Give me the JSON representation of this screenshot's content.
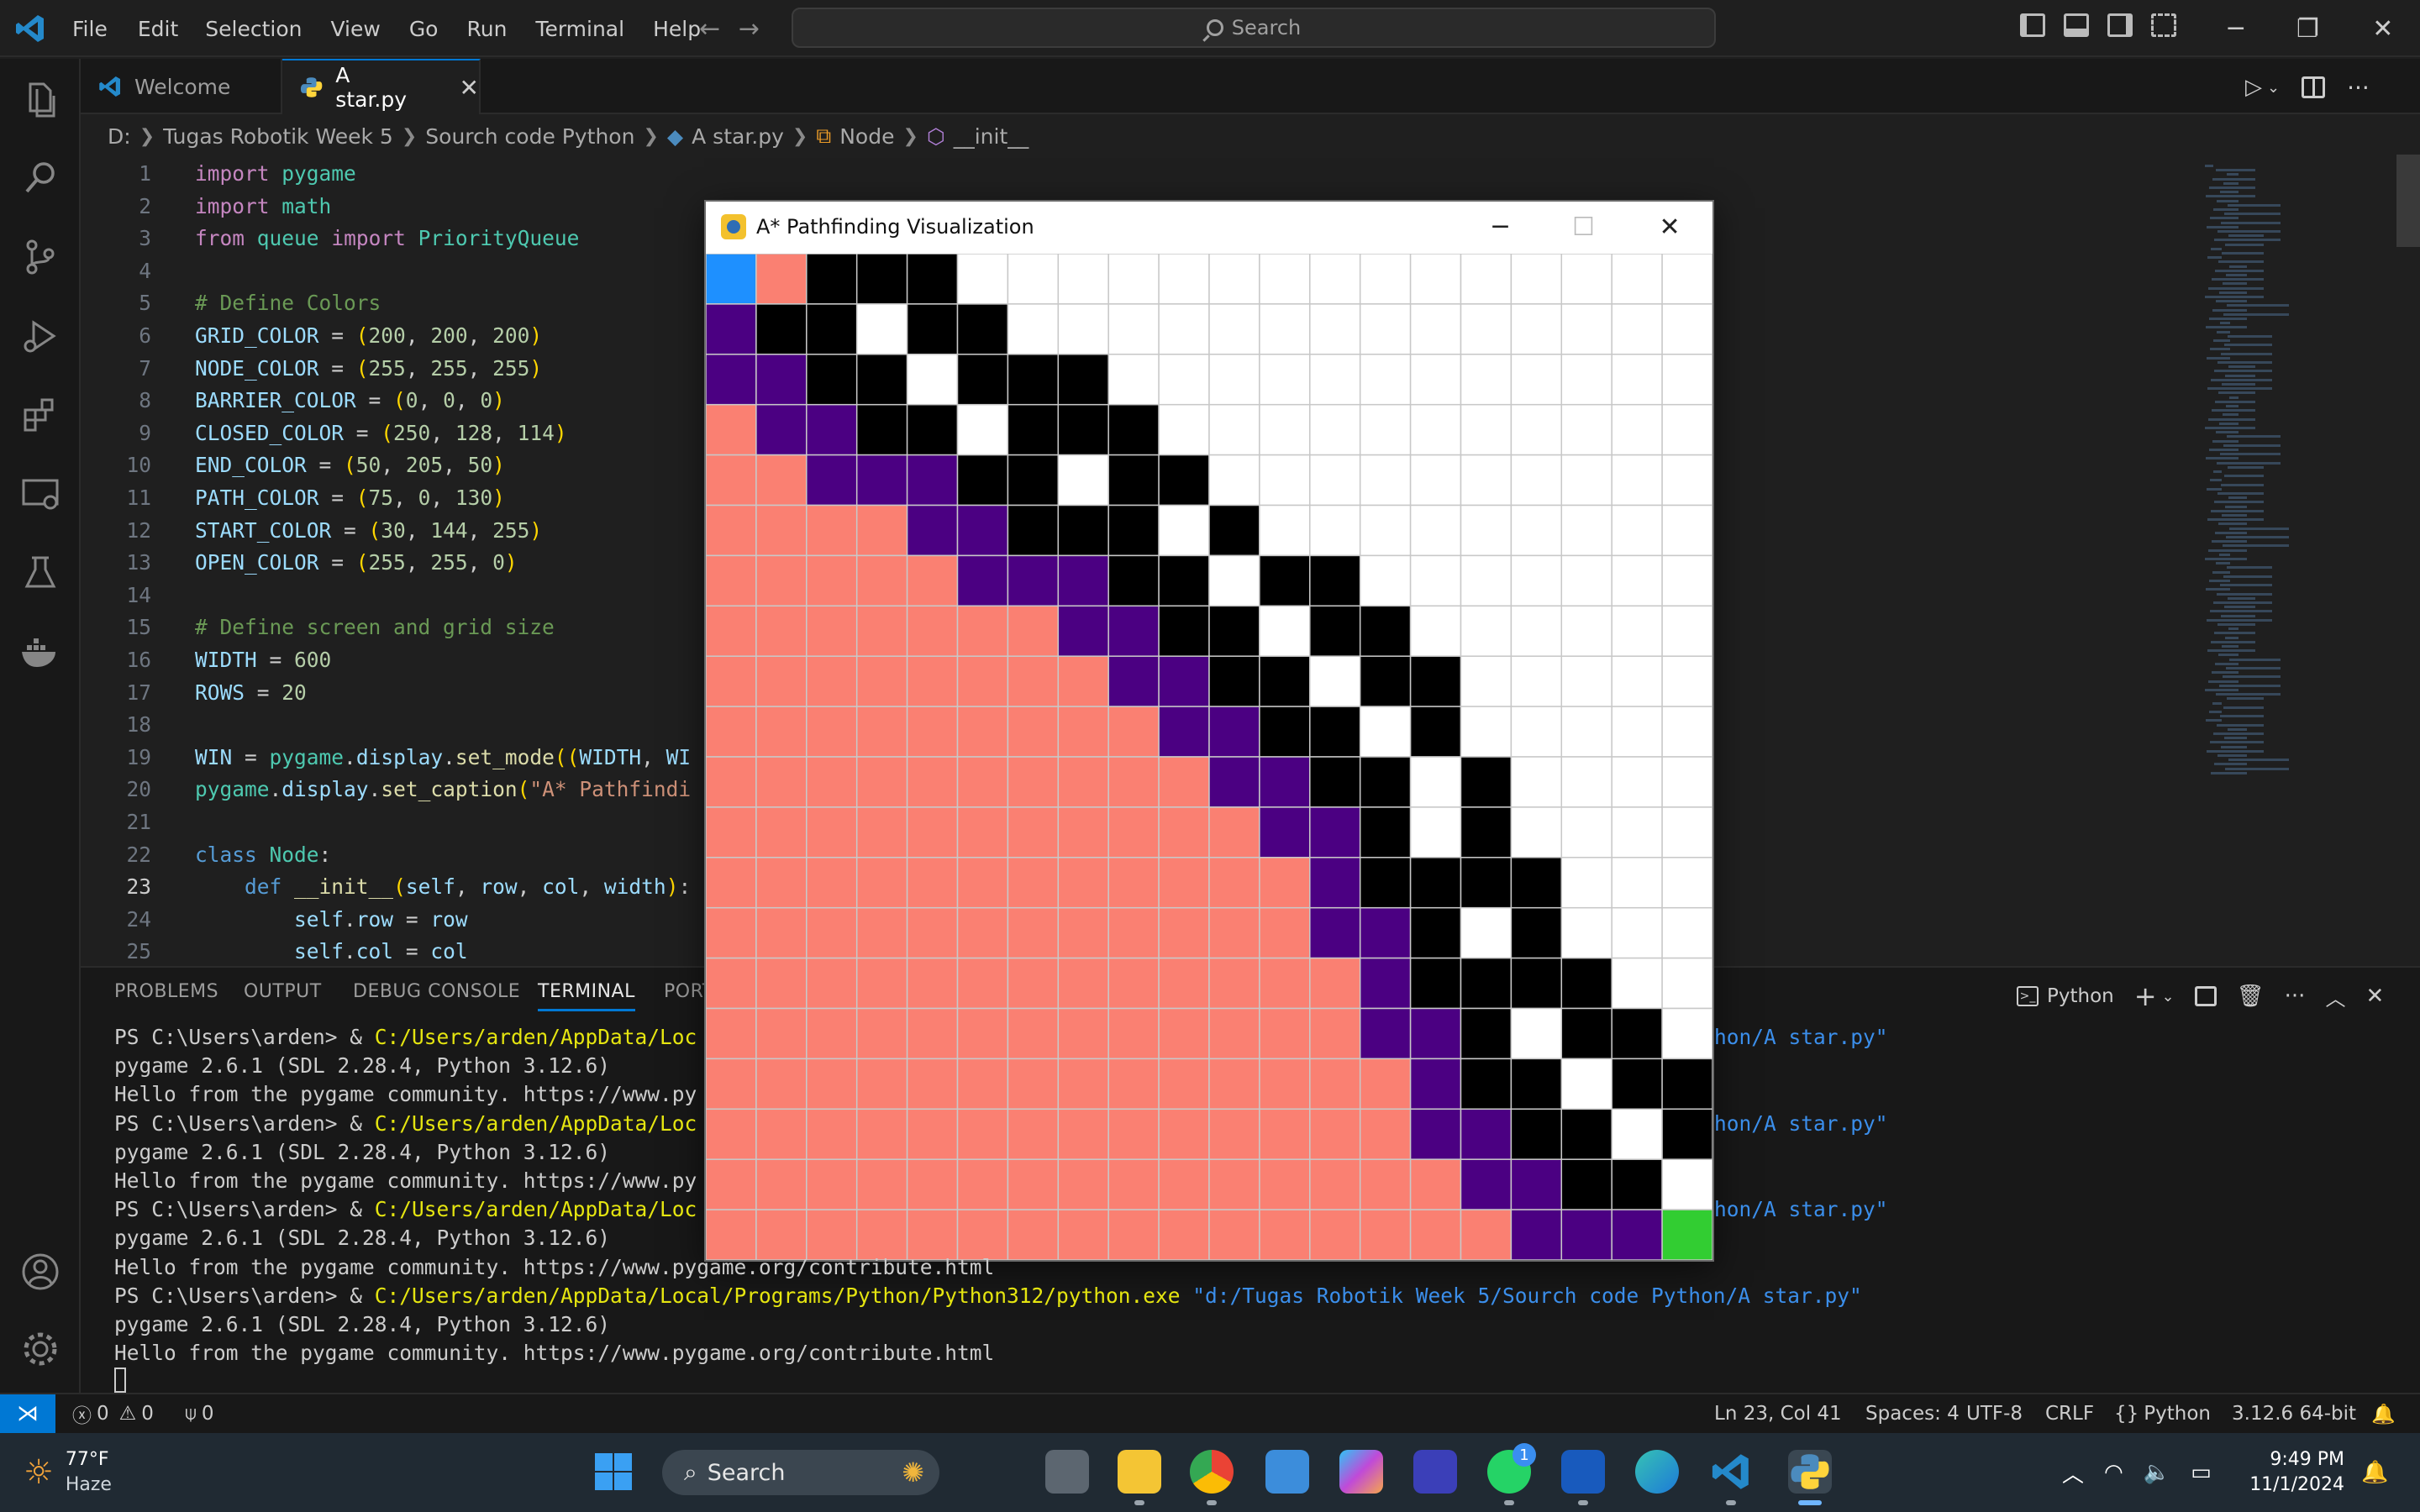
{
  "titlebar": {
    "menu": [
      "File",
      "Edit",
      "Selection",
      "View",
      "Go",
      "Run",
      "Terminal",
      "Help"
    ],
    "search_placeholder": "Search"
  },
  "tabs": [
    {
      "label": "Welcome",
      "active": false
    },
    {
      "label": "A star.py",
      "active": true
    }
  ],
  "breadcrumb": [
    "D:",
    "Tugas Robotik Week 5",
    "Sourch code Python",
    "A star.py",
    "Node",
    "__init__"
  ],
  "editor": {
    "lines": [
      {
        "n": "1",
        "text": "import pygame"
      },
      {
        "n": "2",
        "text": "import math"
      },
      {
        "n": "3",
        "text": "from queue import PriorityQueue"
      },
      {
        "n": "4",
        "text": ""
      },
      {
        "n": "5",
        "text": "# Define Colors"
      },
      {
        "n": "6",
        "text": "GRID_COLOR = (200, 200, 200)"
      },
      {
        "n": "7",
        "text": "NODE_COLOR = (255, 255, 255)"
      },
      {
        "n": "8",
        "text": "BARRIER_COLOR = (0, 0, 0)"
      },
      {
        "n": "9",
        "text": "CLOSED_COLOR = (250, 128, 114)"
      },
      {
        "n": "10",
        "text": "END_COLOR = (50, 205, 50)"
      },
      {
        "n": "11",
        "text": "PATH_COLOR = (75, 0, 130)"
      },
      {
        "n": "12",
        "text": "START_COLOR = (30, 144, 255)"
      },
      {
        "n": "13",
        "text": "OPEN_COLOR = (255, 255, 0)"
      },
      {
        "n": "14",
        "text": ""
      },
      {
        "n": "15",
        "text": "# Define screen and grid size"
      },
      {
        "n": "16",
        "text": "WIDTH = 600"
      },
      {
        "n": "17",
        "text": "ROWS = 20"
      },
      {
        "n": "18",
        "text": ""
      },
      {
        "n": "19",
        "text": "WIN = pygame.display.set_mode((WIDTH, WI"
      },
      {
        "n": "20",
        "text": "pygame.display.set_caption(\"A* Pathfindi"
      },
      {
        "n": "21",
        "text": ""
      },
      {
        "n": "22",
        "text": "class Node:"
      },
      {
        "n": "23",
        "text": "    def __init__(self, row, col, width):"
      },
      {
        "n": "24",
        "text": "        self.row = row"
      },
      {
        "n": "25",
        "text": "        self.col = col"
      }
    ]
  },
  "panel": {
    "tabs": [
      "PROBLEMS",
      "OUTPUT",
      "DEBUG CONSOLE",
      "TERMINAL",
      "PORT"
    ],
    "active_tab": "TERMINAL",
    "shell_label": "Python",
    "terminal": [
      {
        "prompt": "PS C:\\Users\\arden> & ",
        "path": "C:/Users/arden/AppData/Loc",
        "tail": "hon/A star.py\""
      },
      {
        "text": "pygame 2.6.1 (SDL 2.28.4, Python 3.12.6)"
      },
      {
        "text": "Hello from the pygame community. https://www.py"
      },
      {
        "prompt": "PS C:\\Users\\arden> & ",
        "path": "C:/Users/arden/AppData/Loc",
        "tail": "hon/A star.py\""
      },
      {
        "text": "pygame 2.6.1 (SDL 2.28.4, Python 3.12.6)"
      },
      {
        "text": "Hello from the pygame community. https://www.py"
      },
      {
        "prompt": "PS C:\\Users\\arden> & ",
        "path": "C:/Users/arden/AppData/Loc",
        "tail": "hon/A star.py\""
      },
      {
        "text": "pygame 2.6.1 (SDL 2.28.4, Python 3.12.6)"
      },
      {
        "text": "Hello from the pygame community. https://www.pygame.org/contribute.html"
      },
      {
        "prompt": "PS C:\\Users\\arden> & ",
        "path": "C:/Users/arden/AppData/Local/Programs/Python/Python312/python.exe",
        "arg": " \"d:/Tugas Robotik Week 5/Sourch code Python/A star.py\""
      },
      {
        "text": "pygame 2.6.1 (SDL 2.28.4, Python 3.12.6)"
      },
      {
        "text": "Hello from the pygame community. https://www.pygame.org/contribute.html"
      }
    ]
  },
  "statusbar": {
    "errors": "0",
    "warnings": "0",
    "ports": "0",
    "position": "Ln 23, Col 41",
    "spaces": "Spaces: 4",
    "encoding": "UTF-8",
    "eol": "CRLF",
    "language": "Python",
    "interpreter": "3.12.6 64-bit"
  },
  "taskbar": {
    "weather_temp": "77°F",
    "weather_desc": "Haze",
    "search_label": "Search",
    "whatsapp_badge": "1",
    "time": "9:49 PM",
    "date": "11/1/2024"
  },
  "pygame_window": {
    "title": "A* Pathfinding Visualization",
    "colors": {
      "start": "#1e90ff",
      "end": "#32cd32",
      "closed": "#fa8072",
      "barrier": "#000000",
      "path": "#4b0082",
      "empty": "#ffffff",
      "grid": "#c8c8c8"
    },
    "grid_legend": "S=start, E=end, C=closed, B=barrier, P=path, W=empty",
    "grid": [
      "SCBBBWWWWWWWWWWWWWWW",
      "PBBWBBWWWWWWWWWWWWWW",
      "PPBBWBBBWWWWWWWWWWWW",
      "CPPBBWBBBWWWWWWWWWWW",
      "CCPPPBBWBBWWWWWWWWWW",
      "CCCCPPBBBWBWWWWWWWWW",
      "CCCCCPPPBBWBBWWWWWWW",
      "CCCCCCCPPBBWBBWWWWWW",
      "CCCCCCCCPPBBWBBWWWWW",
      "CCCCCCCCCPPBBWBWWWWW",
      "CCCCCCCCCCPPBBWBWWWW",
      "CCCCCCCCCCCPPBWBWWWW",
      "CCCCCCCCCCCCPBBBBWWW",
      "CCCCCCCCCCCCPPBWBWWW",
      "CCCCCCCCCCCCCPBBBBWW",
      "CCCCCCCCCCCCCPPBWBBW",
      "CCCCCCCCCCCCCCPBBWBB",
      "CCCCCCCCCCCCCCPPBBWB",
      "CCCCCCCCCCCCCCCPPBBW",
      "CCCCCCCCCCCCCCCCPPPE"
    ]
  }
}
